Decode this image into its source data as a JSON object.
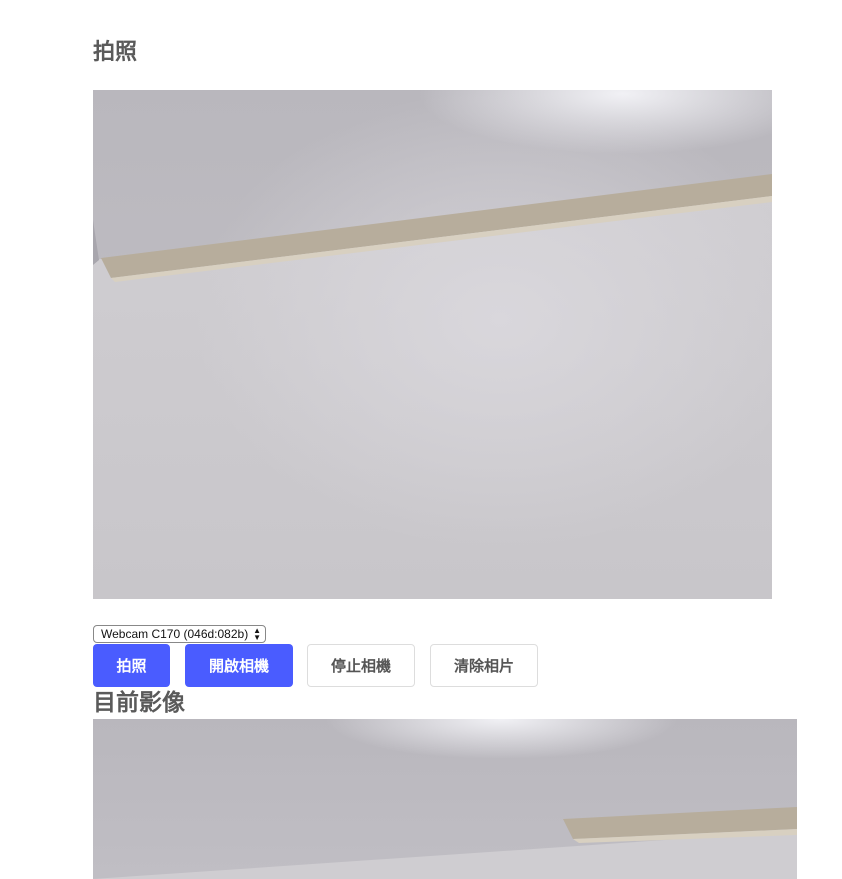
{
  "page": {
    "title": "拍照",
    "preview_title": "目前影像"
  },
  "camera": {
    "selected_device": "Webcam C170 (046d:082b)"
  },
  "controls": {
    "capture_label": "拍照",
    "start_label": "開啟相機",
    "stop_label": "停止相機",
    "clear_label": "清除相片"
  },
  "colors": {
    "primary": "#4a5cff",
    "text": "#5a5a5a",
    "wall": "#c9c7cc",
    "trim": "#b7ad9c"
  }
}
